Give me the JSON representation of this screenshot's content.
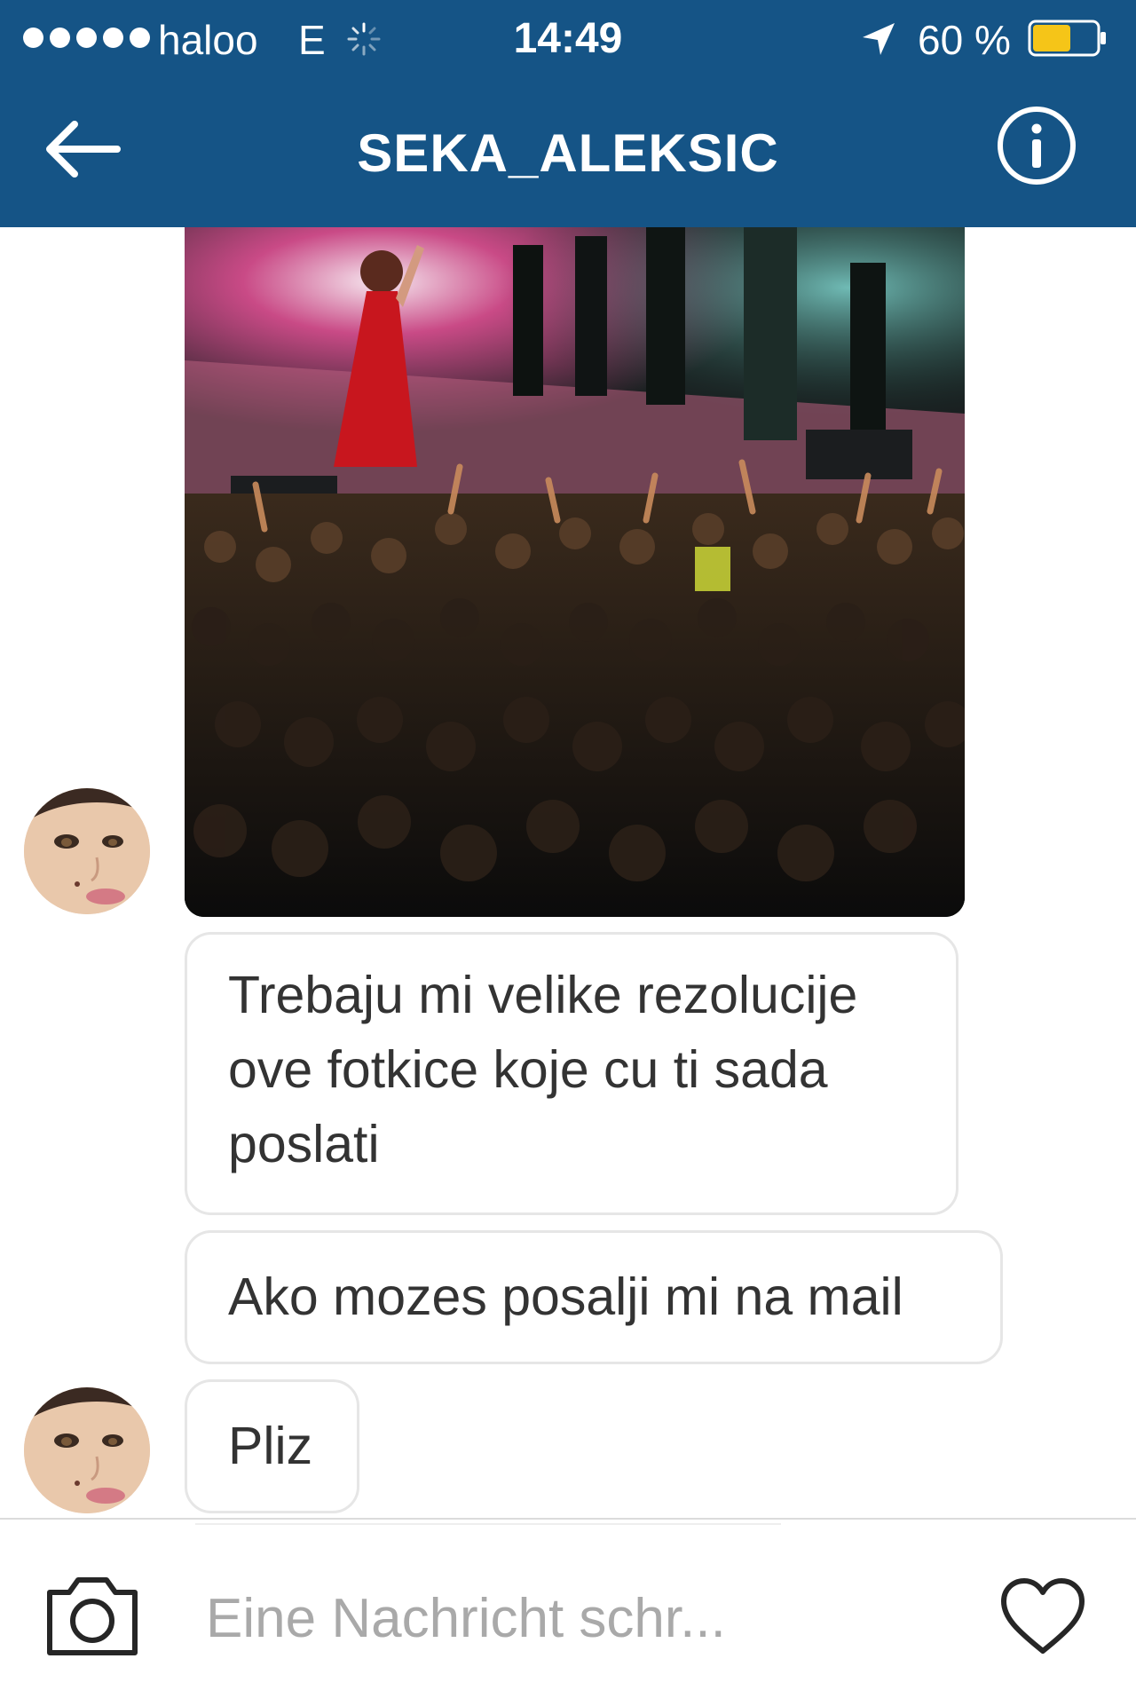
{
  "status_bar": {
    "carrier": "haloo",
    "network": "E",
    "time": "14:49",
    "battery": "60 %",
    "battery_level": 0.6
  },
  "nav": {
    "title": "SEKA_ALEKSIC",
    "back_icon": "arrow-left-icon",
    "info_icon": "info-icon"
  },
  "messages": [
    {
      "type": "photo",
      "content": "concert photo"
    },
    {
      "type": "text",
      "text": "Trebaju mi velike rezolucije ove fotkice koje cu ti sada poslati"
    },
    {
      "type": "text",
      "text": "Ako mozes posalji mi na mail"
    },
    {
      "type": "text",
      "text": "Pliz"
    }
  ],
  "composer": {
    "placeholder": "Eine Nachricht schr...",
    "camera_icon": "camera-icon",
    "like_icon": "heart-icon"
  },
  "colors": {
    "header": "#155486",
    "battery_fill": "#f5c518",
    "bubble_border": "#e6e6e6"
  }
}
